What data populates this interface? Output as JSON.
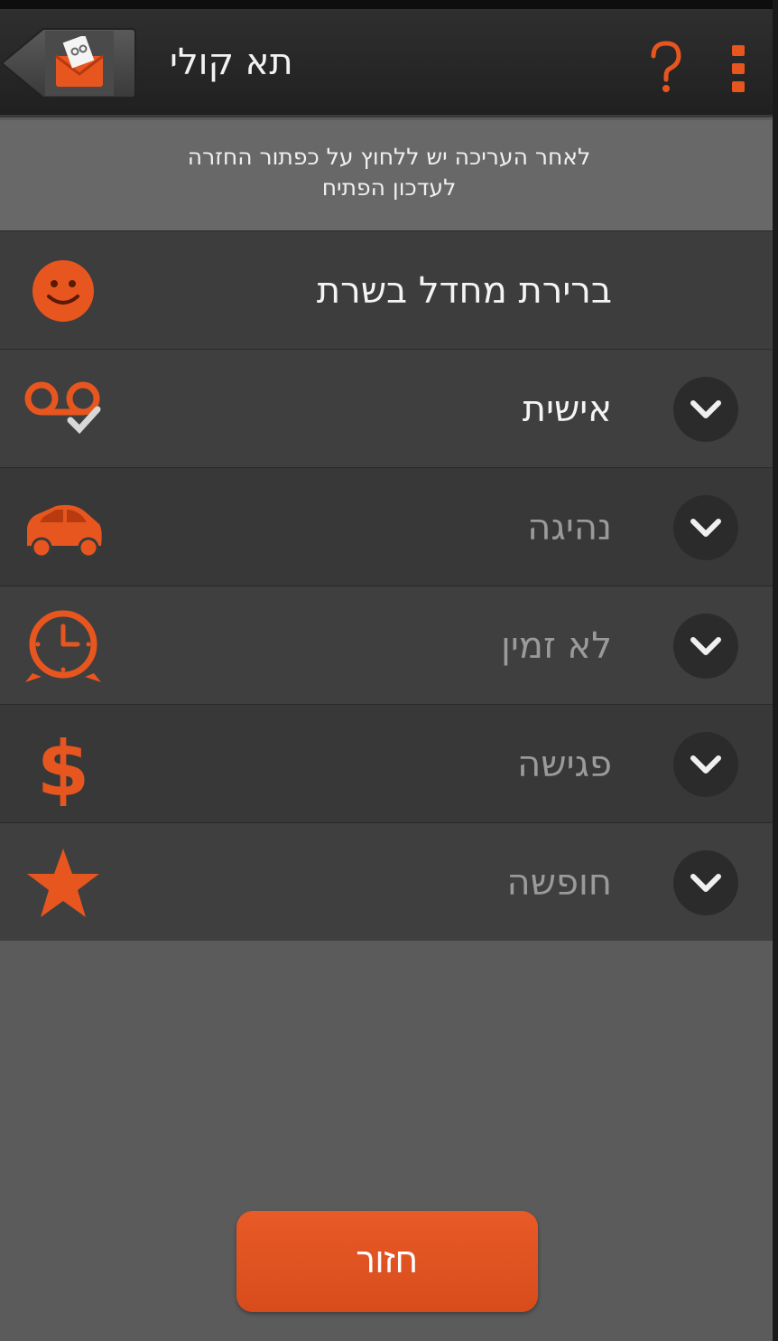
{
  "header": {
    "title": "תא קולי",
    "back_icon": "voicemail-envelope-icon",
    "help_icon": "question-mark-icon",
    "menu_icon": "overflow-menu-icon"
  },
  "notice": {
    "line1": "לאחר העריכה יש ללחוץ על כפתור החזרה",
    "line2": "לעדכון הפתיח"
  },
  "default_row": {
    "label": "ברירת מחדל בשרת",
    "icon": "smiley-icon"
  },
  "profiles": [
    {
      "label": "אישית",
      "icon": "voicemail-check-icon",
      "active": true
    },
    {
      "label": "נהיגה",
      "icon": "car-icon",
      "active": false
    },
    {
      "label": "לא זמין",
      "icon": "alarm-clock-icon",
      "active": false
    },
    {
      "label": "פגישה",
      "icon": "dollar-icon",
      "active": false
    },
    {
      "label": "חופשה",
      "icon": "star-icon",
      "active": false
    }
  ],
  "footer": {
    "back_button": "חזור"
  },
  "colors": {
    "accent": "#e8561f",
    "background": "#5b5b5b",
    "row_bg": "#3d3d3d"
  }
}
